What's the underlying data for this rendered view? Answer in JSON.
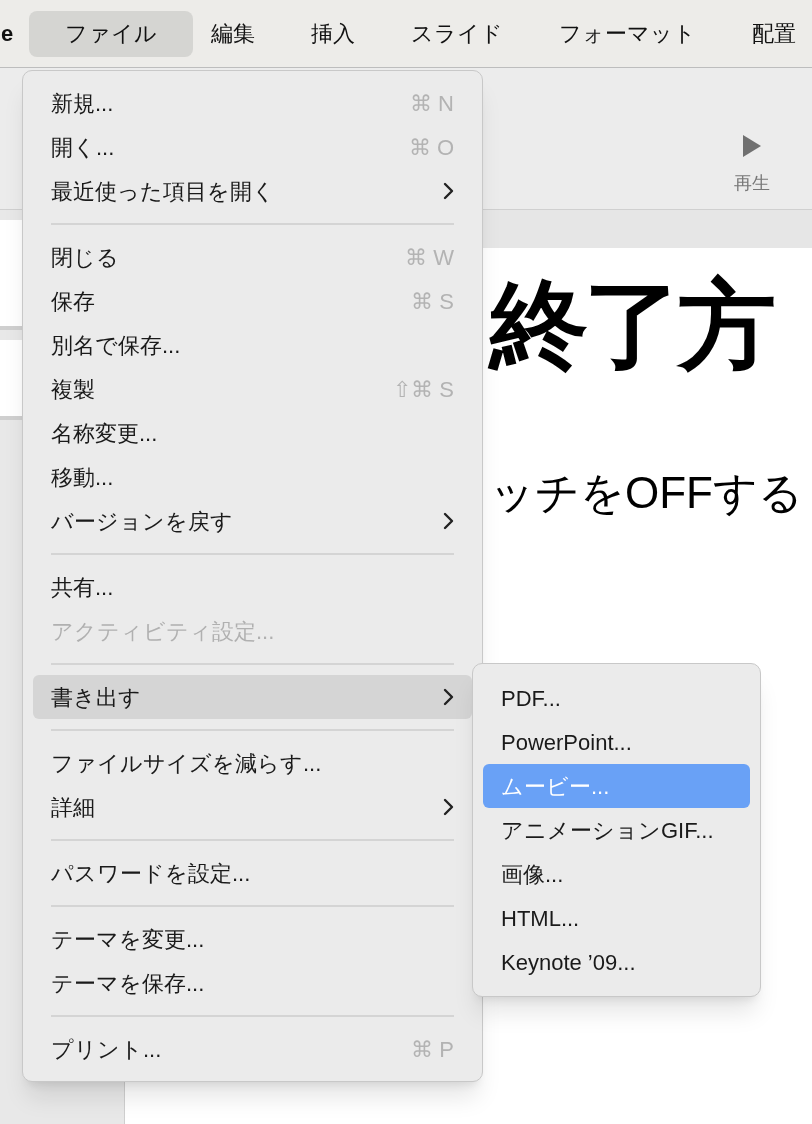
{
  "menubar": {
    "app_name": "e",
    "items": [
      {
        "label": "ファイル",
        "selected": true
      },
      {
        "label": "編集",
        "selected": false
      },
      {
        "label": "挿入",
        "selected": false
      },
      {
        "label": "スライド",
        "selected": false
      },
      {
        "label": "フォーマット",
        "selected": false
      },
      {
        "label": "配置",
        "selected": false
      }
    ]
  },
  "toolbar": {
    "play_label": "再生"
  },
  "slide": {
    "title": "終了方",
    "body": "ッチをOFFする"
  },
  "file_menu": [
    {
      "kind": "item",
      "label": "新規...",
      "shortcut": "⌘ N",
      "submenu": false,
      "disabled": false,
      "selected": false
    },
    {
      "kind": "item",
      "label": "開く...",
      "shortcut": "⌘ O",
      "submenu": false,
      "disabled": false,
      "selected": false
    },
    {
      "kind": "item",
      "label": "最近使った項目を開く",
      "submenu": true,
      "disabled": false,
      "selected": false
    },
    {
      "kind": "separator"
    },
    {
      "kind": "item",
      "label": "閉じる",
      "shortcut": "⌘ W",
      "submenu": false,
      "disabled": false,
      "selected": false
    },
    {
      "kind": "item",
      "label": "保存",
      "shortcut": "⌘ S",
      "submenu": false,
      "disabled": false,
      "selected": false
    },
    {
      "kind": "item",
      "label": "別名で保存...",
      "submenu": false,
      "disabled": false,
      "selected": false
    },
    {
      "kind": "item",
      "label": "複製",
      "shortcut": "⇧⌘ S",
      "submenu": false,
      "disabled": false,
      "selected": false
    },
    {
      "kind": "item",
      "label": "名称変更...",
      "submenu": false,
      "disabled": false,
      "selected": false
    },
    {
      "kind": "item",
      "label": "移動...",
      "submenu": false,
      "disabled": false,
      "selected": false
    },
    {
      "kind": "item",
      "label": "バージョンを戻す",
      "submenu": true,
      "disabled": false,
      "selected": false
    },
    {
      "kind": "separator"
    },
    {
      "kind": "item",
      "label": "共有...",
      "submenu": false,
      "disabled": false,
      "selected": false
    },
    {
      "kind": "item",
      "label": "アクティビティ設定...",
      "submenu": false,
      "disabled": true,
      "selected": false
    },
    {
      "kind": "separator"
    },
    {
      "kind": "item",
      "label": "書き出す",
      "submenu": true,
      "disabled": false,
      "selected": true
    },
    {
      "kind": "separator"
    },
    {
      "kind": "item",
      "label": "ファイルサイズを減らす...",
      "submenu": false,
      "disabled": false,
      "selected": false
    },
    {
      "kind": "item",
      "label": "詳細",
      "submenu": true,
      "disabled": false,
      "selected": false
    },
    {
      "kind": "separator"
    },
    {
      "kind": "item",
      "label": "パスワードを設定...",
      "submenu": false,
      "disabled": false,
      "selected": false
    },
    {
      "kind": "separator"
    },
    {
      "kind": "item",
      "label": "テーマを変更...",
      "submenu": false,
      "disabled": false,
      "selected": false
    },
    {
      "kind": "item",
      "label": "テーマを保存...",
      "submenu": false,
      "disabled": false,
      "selected": false
    },
    {
      "kind": "separator"
    },
    {
      "kind": "item",
      "label": "プリント...",
      "shortcut": "⌘ P",
      "submenu": false,
      "disabled": false,
      "selected": false
    }
  ],
  "export_submenu": [
    {
      "label": "PDF...",
      "selected": false
    },
    {
      "label": "PowerPoint...",
      "selected": false
    },
    {
      "label": "ムービー...",
      "selected": true
    },
    {
      "label": "アニメーションGIF...",
      "selected": false
    },
    {
      "label": "画像...",
      "selected": false
    },
    {
      "label": "HTML...",
      "selected": false
    },
    {
      "label": "Keynote ’09...",
      "selected": false
    }
  ]
}
